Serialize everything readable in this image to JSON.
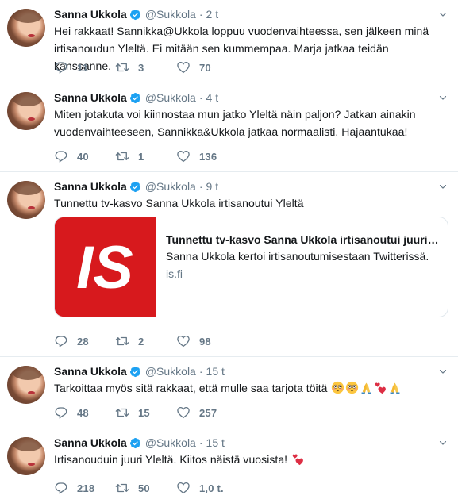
{
  "colors": {
    "verified": "#1da1f2",
    "muted": "#657786",
    "heart": "#e0245e",
    "card_thumb": "#d7191d"
  },
  "tweets": [
    {
      "name": "Sanna Ukkola",
      "handle": "@Sukkola",
      "dot": "·",
      "time": "2 t",
      "text": "Hei rakkaat! Sannikka@Ukkola loppuu vuodenvaihteessa, sen jälkeen minä irtisanoudun Yleltä. Ei mitään sen kummempaa. Marja jatkaa teidän kanssanne.",
      "replies": "11",
      "retweets": "3",
      "likes": "70"
    },
    {
      "name": "Sanna Ukkola",
      "handle": "@Sukkola",
      "dot": "·",
      "time": "4 t",
      "text": "Miten jotakuta voi kiinnostaa mun jatko Yleltä näin paljon? Jatkan ainakin vuodenvaihteeseen, Sannikka&Ukkola jatkaa normaalisti. Hajaantukaa!",
      "replies": "40",
      "retweets": "1",
      "likes": "136"
    },
    {
      "name": "Sanna Ukkola",
      "handle": "@Sukkola",
      "dot": "·",
      "time": "9 t",
      "text": "Tunnettu tv-kasvo Sanna Ukkola irtisanoutui Yleltä",
      "card": {
        "logo": "IS",
        "title": "Tunnettu tv-kasvo Sanna Ukkola irtisanoutui juuri Yleltä",
        "description": "Sanna Ukkola kertoi irtisanoutumisestaan Twitterissä.",
        "domain": "is.fi"
      },
      "replies": "28",
      "retweets": "2",
      "likes": "98"
    },
    {
      "name": "Sanna Ukkola",
      "handle": "@Sukkola",
      "dot": "·",
      "time": "15 t",
      "text": "Tarkoittaa myös sitä rakkaat, että mulle saa tarjota töitä",
      "emojis": [
        "flushed-face-emoji",
        "flushed-face-emoji",
        "folded-hands-emoji",
        "two-hearts-emoji",
        "folded-hands-emoji"
      ],
      "replies": "48",
      "retweets": "15",
      "likes": "257"
    },
    {
      "name": "Sanna Ukkola",
      "handle": "@Sukkola",
      "dot": "·",
      "time": "15 t",
      "text": "Irtisanouduin juuri Yleltä. Kiitos näistä vuosista!",
      "emojis": [
        "two-hearts-emoji"
      ],
      "replies": "218",
      "retweets": "50",
      "likes": "1,0 t."
    }
  ]
}
